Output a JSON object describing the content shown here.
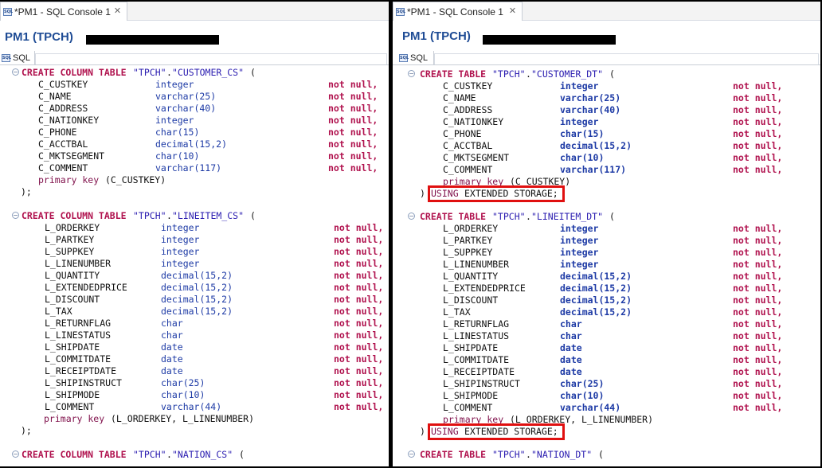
{
  "colors": {
    "keyword": "#b0124e",
    "string": "#2a1cb0",
    "type": "#1d3aa5",
    "connection": "#1f4c95",
    "highlight": "#e01010"
  },
  "icons": [
    "sql-icon",
    "close-icon",
    "fold-collapse-icon"
  ],
  "left": {
    "tab_title": "*PM1 - SQL Console 1",
    "close_glyph": "✕",
    "connection": "PM1 (TPCH)",
    "subtab": "SQL",
    "tables": [
      {
        "create": "CREATE COLUMN TABLE",
        "schema": "\"TPCH\"",
        "dot": ".",
        "name": "\"CUSTOMER_CS\"",
        "open": "(",
        "columns": [
          [
            "C_CUSTKEY",
            "integer",
            "not null,"
          ],
          [
            "C_NAME",
            "varchar(25)",
            "not null,"
          ],
          [
            "C_ADDRESS",
            "varchar(40)",
            "not null,"
          ],
          [
            "C_NATIONKEY",
            "integer",
            "not null,"
          ],
          [
            "C_PHONE",
            "char(15)",
            "not null,"
          ],
          [
            "C_ACCTBAL",
            "decimal(15,2)",
            "not null,"
          ],
          [
            "C_MKTSEGMENT",
            "char(10)",
            "not null,"
          ],
          [
            "C_COMMENT",
            "varchar(117)",
            "not null,"
          ]
        ],
        "pk_keyword": "primary key",
        "pk_cols": "(C_CUSTKEY)",
        "close": ");"
      },
      {
        "create": "CREATE COLUMN TABLE",
        "schema": "\"TPCH\"",
        "dot": ".",
        "name": "\"LINEITEM_CS\"",
        "open": "(",
        "columns": [
          [
            "L_ORDERKEY",
            "integer",
            "not null,"
          ],
          [
            "L_PARTKEY",
            "integer",
            "not null,"
          ],
          [
            "L_SUPPKEY",
            "integer",
            "not null,"
          ],
          [
            "L_LINENUMBER",
            "integer",
            "not null,"
          ],
          [
            "L_QUANTITY",
            "decimal(15,2)",
            "not null,"
          ],
          [
            "L_EXTENDEDPRICE",
            "decimal(15,2)",
            "not null,"
          ],
          [
            "L_DISCOUNT",
            "decimal(15,2)",
            "not null,"
          ],
          [
            "L_TAX",
            "decimal(15,2)",
            "not null,"
          ],
          [
            "L_RETURNFLAG",
            "char",
            "not null,"
          ],
          [
            "L_LINESTATUS",
            "char",
            "not null,"
          ],
          [
            "L_SHIPDATE",
            "date",
            "not null,"
          ],
          [
            "L_COMMITDATE",
            "date",
            "not null,"
          ],
          [
            "L_RECEIPTDATE",
            "date",
            "not null,"
          ],
          [
            "L_SHIPINSTRUCT",
            "char(25)",
            "not null,"
          ],
          [
            "L_SHIPMODE",
            "char(10)",
            "not null,"
          ],
          [
            "L_COMMENT",
            "varchar(44)",
            "not null,"
          ]
        ],
        "pk_keyword": "primary key",
        "pk_cols": "(L_ORDERKEY, L_LINENUMBER)",
        "close": ");"
      },
      {
        "create": "CREATE COLUMN TABLE",
        "schema": "\"TPCH\"",
        "dot": ".",
        "name": "\"NATION_CS\"",
        "open": "("
      }
    ]
  },
  "right": {
    "tab_title": "*PM1 - SQL Console 1",
    "close_glyph": "✕",
    "connection": "PM1 (TPCH)",
    "subtab": "SQL",
    "tables": [
      {
        "create": "CREATE TABLE",
        "schema": "\"TPCH\"",
        "dot": ".",
        "name": "\"CUSTOMER_DT\"",
        "open": "(",
        "columns": [
          [
            "C_CUSTKEY",
            "integer",
            "not null,"
          ],
          [
            "C_NAME",
            "varchar(25)",
            "not null,"
          ],
          [
            "C_ADDRESS",
            "varchar(40)",
            "not null,"
          ],
          [
            "C_NATIONKEY",
            "integer",
            "not null,"
          ],
          [
            "C_PHONE",
            "char(15)",
            "not null,"
          ],
          [
            "C_ACCTBAL",
            "decimal(15,2)",
            "not null,"
          ],
          [
            "C_MKTSEGMENT",
            "char(10)",
            "not null,"
          ],
          [
            "C_COMMENT",
            "varchar(117)",
            "not null,"
          ]
        ],
        "pk_keyword": "primary key",
        "pk_cols": "(C_CUSTKEY)",
        "close_paren": ")",
        "using_kw": "USING",
        "using_rest": "EXTENDED STORAGE;"
      },
      {
        "create": "CREATE TABLE",
        "schema": "\"TPCH\"",
        "dot": ".",
        "name": "\"LINEITEM_DT\"",
        "open": "(",
        "columns": [
          [
            "L_ORDERKEY",
            "integer",
            "not null,"
          ],
          [
            "L_PARTKEY",
            "integer",
            "not null,"
          ],
          [
            "L_SUPPKEY",
            "integer",
            "not null,"
          ],
          [
            "L_LINENUMBER",
            "integer",
            "not null,"
          ],
          [
            "L_QUANTITY",
            "decimal(15,2)",
            "not null,"
          ],
          [
            "L_EXTENDEDPRICE",
            "decimal(15,2)",
            "not null,"
          ],
          [
            "L_DISCOUNT",
            "decimal(15,2)",
            "not null,"
          ],
          [
            "L_TAX",
            "decimal(15,2)",
            "not null,"
          ],
          [
            "L_RETURNFLAG",
            "char",
            "not null,"
          ],
          [
            "L_LINESTATUS",
            "char",
            "not null,"
          ],
          [
            "L_SHIPDATE",
            "date",
            "not null,"
          ],
          [
            "L_COMMITDATE",
            "date",
            "not null,"
          ],
          [
            "L_RECEIPTDATE",
            "date",
            "not null,"
          ],
          [
            "L_SHIPINSTRUCT",
            "char(25)",
            "not null,"
          ],
          [
            "L_SHIPMODE",
            "char(10)",
            "not null,"
          ],
          [
            "L_COMMENT",
            "varchar(44)",
            "not null,"
          ]
        ],
        "pk_keyword": "primary key",
        "pk_cols": "(L_ORDERKEY, L_LINENUMBER)",
        "close_paren": ")",
        "using_kw": "USING",
        "using_rest": "EXTENDED STORAGE;"
      },
      {
        "create": "CREATE TABLE",
        "schema": "\"TPCH\"",
        "dot": ".",
        "name": "\"NATION_DT\"",
        "open": "("
      }
    ]
  }
}
